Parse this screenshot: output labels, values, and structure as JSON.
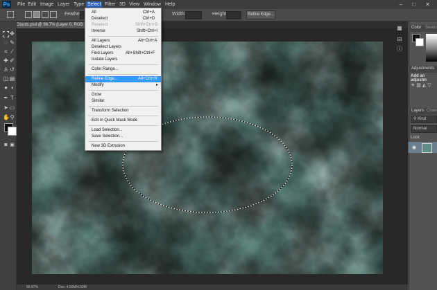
{
  "menubar": {
    "logo": "Ps",
    "items": [
      "File",
      "Edit",
      "Image",
      "Layer",
      "Type",
      "Select",
      "Filter",
      "3D",
      "View",
      "Window",
      "Help"
    ],
    "window_controls": "– □ ✕"
  },
  "options_bar": {
    "feather_label": "Feather:",
    "width_label": "Width:",
    "height_label": "Height:",
    "refine_edge_label": "Refine Edge..."
  },
  "document": {
    "tab_title": "Clouds.psd @ 66.7% (Layer 0, RGB",
    "close": "×",
    "zoom": "66.67%",
    "doc_info": "Doc: 4.50M/4.50M"
  },
  "select_menu": {
    "items": [
      {
        "label": "All",
        "shortcut": "Ctrl+A",
        "disabled": false
      },
      {
        "label": "Deselect",
        "shortcut": "Ctrl+D",
        "disabled": false
      },
      {
        "label": "Reselect",
        "shortcut": "Shift+Ctrl+D",
        "disabled": true
      },
      {
        "label": "Inverse",
        "shortcut": "Shift+Ctrl+I",
        "disabled": false
      },
      {
        "label": "All Layers",
        "shortcut": "Alt+Ctrl+A",
        "disabled": false
      },
      {
        "label": "Deselect Layers",
        "shortcut": "",
        "disabled": false
      },
      {
        "label": "Find Layers",
        "shortcut": "Alt+Shift+Ctrl+F",
        "disabled": false
      },
      {
        "label": "Isolate Layers",
        "shortcut": "",
        "disabled": false
      },
      {
        "label": "Color Range...",
        "shortcut": "",
        "disabled": false
      },
      {
        "label": "Refine Edge...",
        "shortcut": "Alt+Ctrl+R",
        "disabled": false,
        "highlighted": true
      },
      {
        "label": "Modify",
        "shortcut": "",
        "disabled": false,
        "submenu": true
      },
      {
        "label": "Grow",
        "shortcut": "",
        "disabled": false
      },
      {
        "label": "Similar",
        "shortcut": "",
        "disabled": false
      },
      {
        "label": "Transform Selection",
        "shortcut": "",
        "disabled": false
      },
      {
        "label": "Edit in Quick Mask Mode",
        "shortcut": "",
        "disabled": false
      },
      {
        "label": "Load Selection...",
        "shortcut": "",
        "disabled": false
      },
      {
        "label": "Save Selection...",
        "shortcut": "",
        "disabled": false
      },
      {
        "label": "New 3D Extrusion",
        "shortcut": "",
        "disabled": false
      }
    ],
    "submenu_arrow": "▸"
  },
  "panels": {
    "color_tab": "Color",
    "swatches_tab": "Swatch",
    "adjustments_tab": "Adjustments",
    "adjustments_hint": "Add an adjustm",
    "layers_tab": "Layers",
    "channels_tab": "Chann",
    "kind_filter": "Kind",
    "blend_mode": "Normal",
    "lock_label": "Lock:"
  },
  "colors": {
    "accent": "#3399ff",
    "menu_bg": "#f0f0f0",
    "canvas_base": "#5f8d85"
  }
}
